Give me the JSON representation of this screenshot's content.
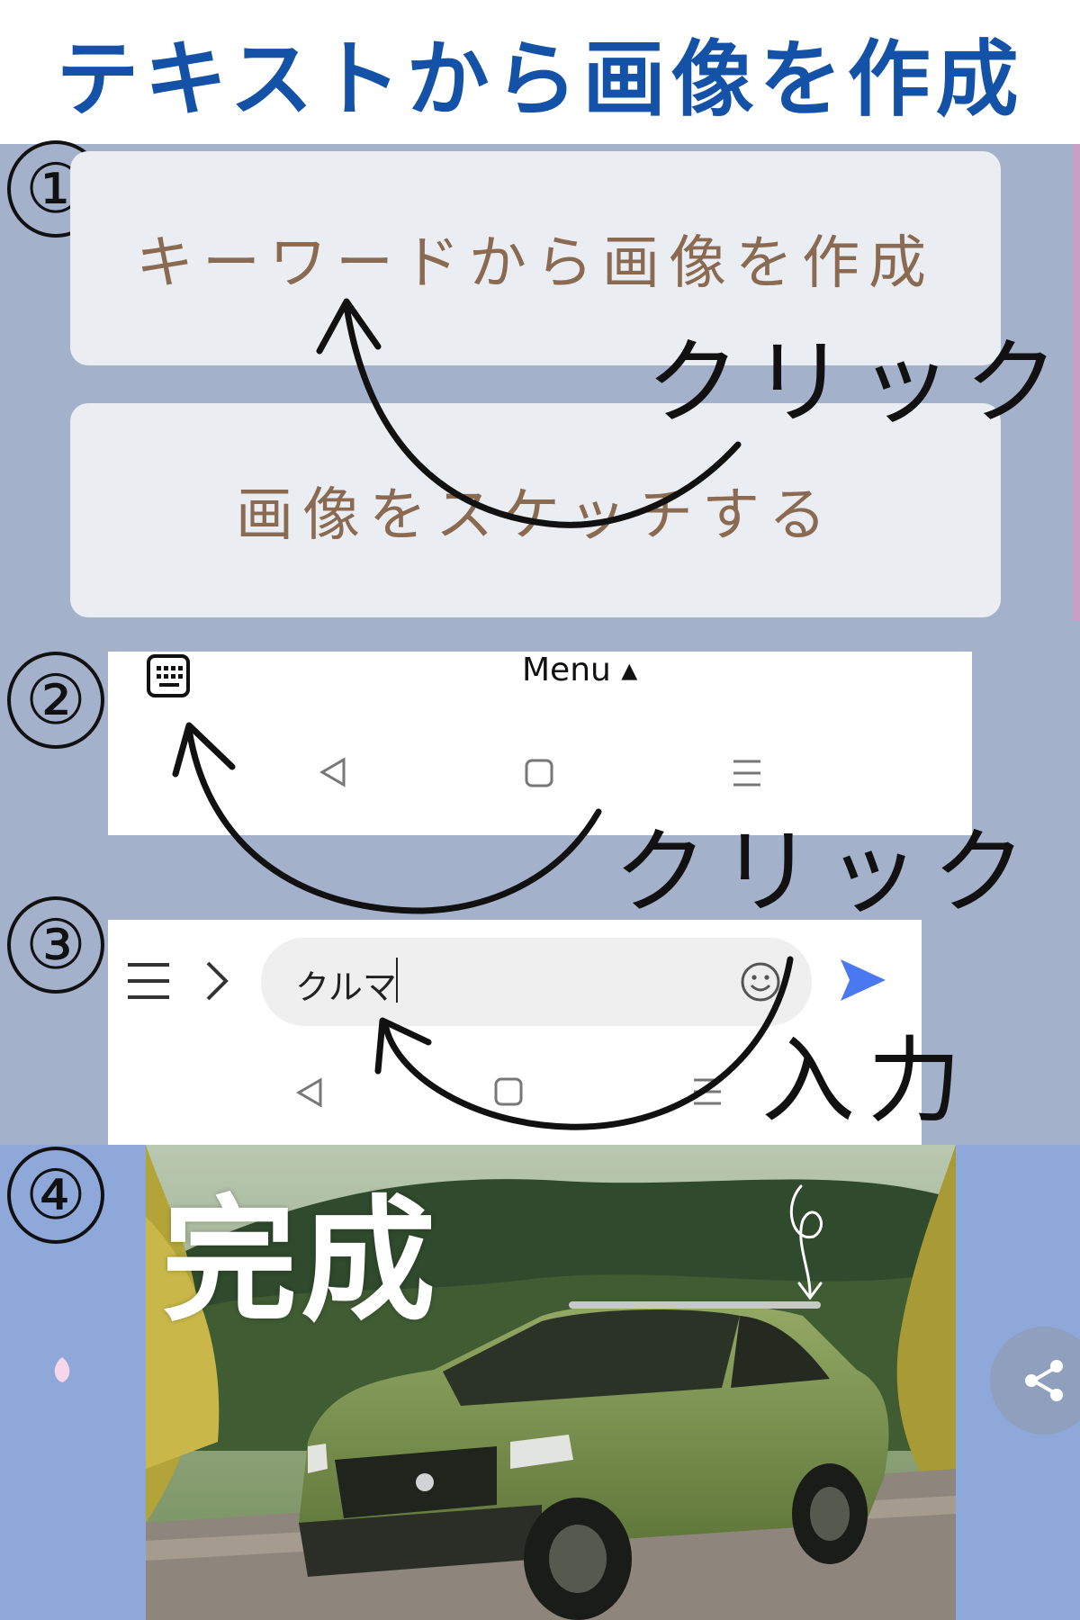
{
  "title": "テキストから画像を作成",
  "steps": {
    "s1": "①",
    "s2": "②",
    "s3": "③",
    "s4": "④"
  },
  "menu": {
    "keyword_option": "キーワードから画像を作成",
    "sketch_option": "画像をスケッチする"
  },
  "annotations": {
    "click1": "クリック",
    "click2": "クリック",
    "input": "入力",
    "done": "完成"
  },
  "keyboard_bar": {
    "menu_label": "Menu ▴"
  },
  "chat_input": {
    "value": "クルマ"
  },
  "colors": {
    "title": "#1452a8",
    "panel": "#a3b1ca",
    "card": "#eaedf2",
    "card_text": "#8a6a51",
    "send": "#4a78f0"
  },
  "icons": {
    "keyboard": "keyboard-icon",
    "back": "back-triangle-icon",
    "home": "home-square-icon",
    "recents": "recents-lines-icon",
    "hamburger": "hamburger-icon",
    "chevron": "chevron-right-icon",
    "emoji": "smiley-icon",
    "send": "send-arrow-icon",
    "share": "share-icon"
  }
}
